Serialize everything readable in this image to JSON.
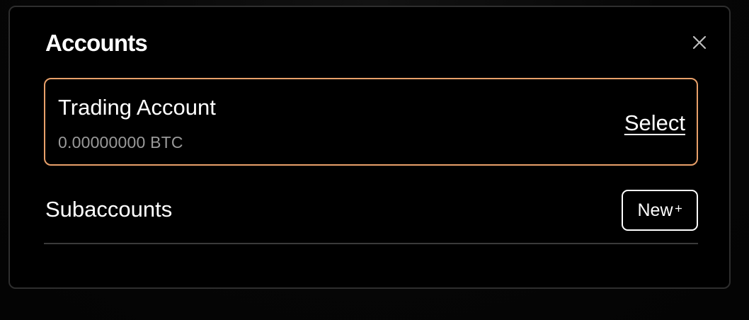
{
  "modal": {
    "title": "Accounts",
    "close_icon": "close-icon"
  },
  "account": {
    "name": "Trading Account",
    "balance": "0.00000000 BTC",
    "select_label": "Select",
    "highlight_color": "#e8a06a"
  },
  "subaccounts": {
    "label": "Subaccounts",
    "new_button_label": "New",
    "new_button_icon": "plus-icon"
  }
}
